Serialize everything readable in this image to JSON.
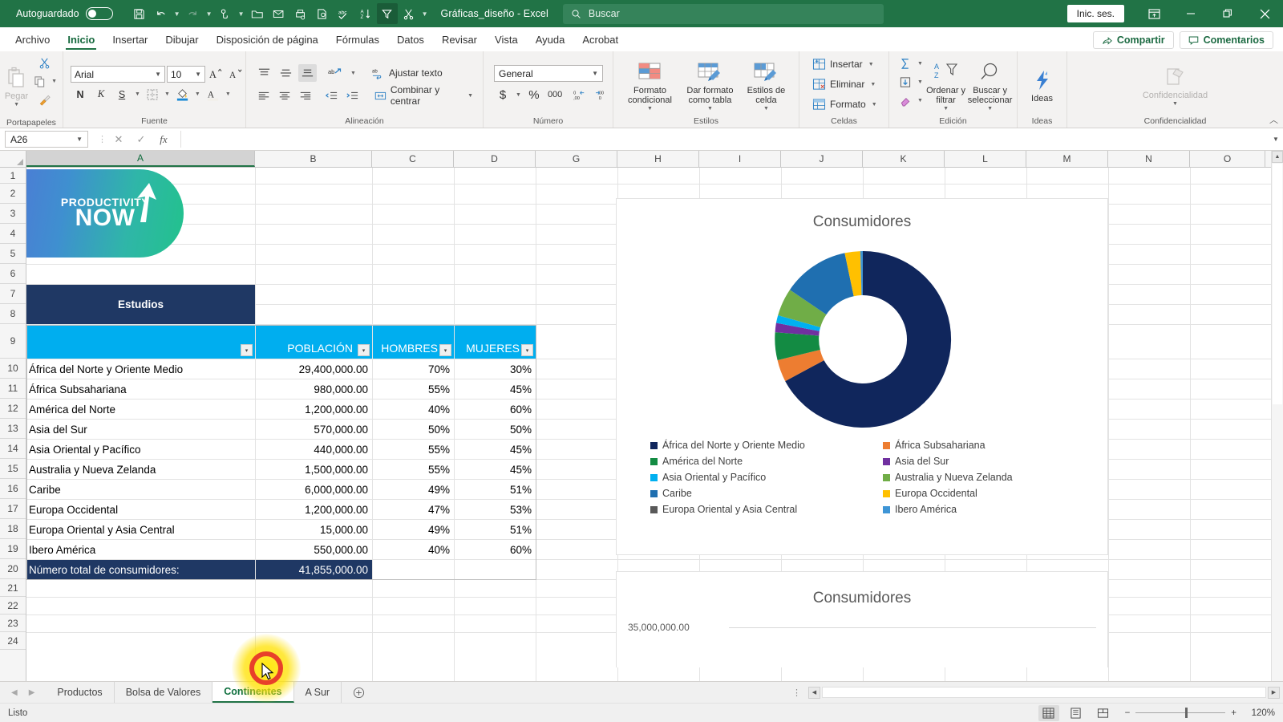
{
  "titlebar": {
    "autosave_label": "Autoguardado",
    "autosave_state": "off",
    "doc_title": "Gráficas_diseño  -  Excel",
    "search_placeholder": "Buscar",
    "signin_label": "Inic. ses.",
    "qat": [
      "save-icon",
      "undo-icon",
      "redo-icon",
      "touch-mode-icon",
      "open-icon",
      "email-icon",
      "quick-print-icon",
      "print-preview-icon",
      "spelling-icon",
      "sort-az-icon",
      "filter-icon",
      "cut-icon",
      "customize-icon"
    ],
    "window_buttons": [
      "ribbon-display-options",
      "minimize",
      "restore",
      "close"
    ]
  },
  "ribbon_tabs": {
    "items": [
      "Archivo",
      "Inicio",
      "Insertar",
      "Dibujar",
      "Disposición de página",
      "Fórmulas",
      "Datos",
      "Revisar",
      "Vista",
      "Ayuda",
      "Acrobat"
    ],
    "selected": "Inicio",
    "share_label": "Compartir",
    "comments_label": "Comentarios"
  },
  "ribbon": {
    "groups": [
      {
        "name": "Portapapeles",
        "label": "Portapapeles",
        "paste_label": "Pegar"
      },
      {
        "name": "Fuente",
        "label": "Fuente",
        "font_name": "Arial",
        "font_size": "10",
        "buttons": [
          "N",
          "K",
          "S"
        ]
      },
      {
        "name": "Alineación",
        "label": "Alineación",
        "wrap_label": "Ajustar texto",
        "merge_label": "Combinar y centrar"
      },
      {
        "name": "Número",
        "label": "Número",
        "format": "General",
        "percent": "%",
        "thousands": "000"
      },
      {
        "name": "Estilos",
        "label": "Estilos",
        "items": [
          "Formato condicional",
          "Dar formato como tabla",
          "Estilos de celda"
        ]
      },
      {
        "name": "Celdas",
        "label": "Celdas",
        "items": [
          "Insertar",
          "Eliminar",
          "Formato"
        ]
      },
      {
        "name": "Edición",
        "label": "Edición",
        "items": [
          "Ordenar y filtrar",
          "Buscar y seleccionar"
        ]
      },
      {
        "name": "Ideas",
        "label": "Ideas",
        "button": "Ideas"
      },
      {
        "name": "Confidencialidad",
        "label": "Confidencialidad",
        "button": "Confidencialidad"
      }
    ]
  },
  "formula_bar": {
    "name_box": "A26",
    "formula_value": "",
    "cancel_icon": "close-icon",
    "confirm_icon": "check-icon",
    "function_icon": "fx-icon"
  },
  "grid": {
    "columns": [
      "A",
      "B",
      "C",
      "D",
      "G",
      "H",
      "I",
      "J",
      "K",
      "L",
      "M",
      "N",
      "O"
    ],
    "selected_column": "A",
    "rows": [
      1,
      2,
      3,
      4,
      5,
      6,
      7,
      8,
      9,
      10,
      11,
      12,
      13,
      14,
      15,
      16,
      17,
      18,
      19,
      20,
      21,
      22,
      23,
      24
    ],
    "logo": {
      "line1": "PRODUCTIVITY",
      "line2": "NOW"
    },
    "section_header": "Estudios",
    "table_headers": [
      "",
      "POBLACIÓN",
      "HOMBRES",
      "MUJERES"
    ],
    "table_rows": [
      {
        "row": 10,
        "name": "África del Norte y Oriente Medio",
        "poblacion": "29,400,000.00",
        "hombres": "70%",
        "mujeres": "30%"
      },
      {
        "row": 11,
        "name": "África Subsahariana",
        "poblacion": "980,000.00",
        "hombres": "55%",
        "mujeres": "45%"
      },
      {
        "row": 12,
        "name": "América del Norte",
        "poblacion": "1,200,000.00",
        "hombres": "40%",
        "mujeres": "60%"
      },
      {
        "row": 13,
        "name": "Asia del Sur",
        "poblacion": "570,000.00",
        "hombres": "50%",
        "mujeres": "50%"
      },
      {
        "row": 14,
        "name": "Asia Oriental y Pacífico",
        "poblacion": "440,000.00",
        "hombres": "55%",
        "mujeres": "45%"
      },
      {
        "row": 15,
        "name": "Australia y Nueva Zelanda",
        "poblacion": "1,500,000.00",
        "hombres": "55%",
        "mujeres": "45%"
      },
      {
        "row": 16,
        "name": "Caribe",
        "poblacion": "6,000,000.00",
        "hombres": "49%",
        "mujeres": "51%"
      },
      {
        "row": 17,
        "name": "Europa Occidental",
        "poblacion": "1,200,000.00",
        "hombres": "47%",
        "mujeres": "53%"
      },
      {
        "row": 18,
        "name": "Europa Oriental y Asia Central",
        "poblacion": "15,000.00",
        "hombres": "49%",
        "mujeres": "51%"
      },
      {
        "row": 19,
        "name": "Ibero América",
        "poblacion": "550,000.00",
        "hombres": "40%",
        "mujeres": "60%"
      }
    ],
    "total_label": "Número total de consumidores:",
    "total_value": "41,855,000.00"
  },
  "chart_data": [
    {
      "type": "pie",
      "variant": "doughnut",
      "title": "Consumidores",
      "legend_position": "bottom",
      "labels": [
        "África del Norte y Oriente Medio",
        "África Subsahariana",
        "América del Norte",
        "Asia del Sur",
        "Asia Oriental y Pacífico",
        "Australia y Nueva Zelanda",
        "Caribe",
        "Europa Occidental",
        "Europa Oriental y Asia Central",
        "Ibero América"
      ],
      "values": [
        29400000,
        980000,
        1200000,
        570000,
        440000,
        1500000,
        6000000,
        1200000,
        15000,
        550000
      ],
      "colors": [
        "#10265C",
        "#ED7D31",
        "#138B43",
        "#7030A0",
        "#00B0F0",
        "#70AD47",
        "#1F6FB0",
        "#FFC000",
        "#595959",
        "#3E95D6"
      ],
      "total": 41855000
    },
    {
      "type": "bar",
      "title": "Consumidores",
      "ylabel": "",
      "ytick_top": "35,000,000.00",
      "ylim": [
        0,
        35000000
      ]
    }
  ],
  "sheet_tabs": {
    "items": [
      "Productos",
      "Bolsa de Valores",
      "Continentes",
      "A Sur"
    ],
    "selected": "Continentes",
    "add_label": "+"
  },
  "status_bar": {
    "text": "Listo",
    "views": [
      "normal-view-icon",
      "page-layout-icon",
      "page-break-icon"
    ],
    "selected_view": "normal-view-icon",
    "zoom": "120%",
    "zoom_out": "−",
    "zoom_in": "+"
  }
}
